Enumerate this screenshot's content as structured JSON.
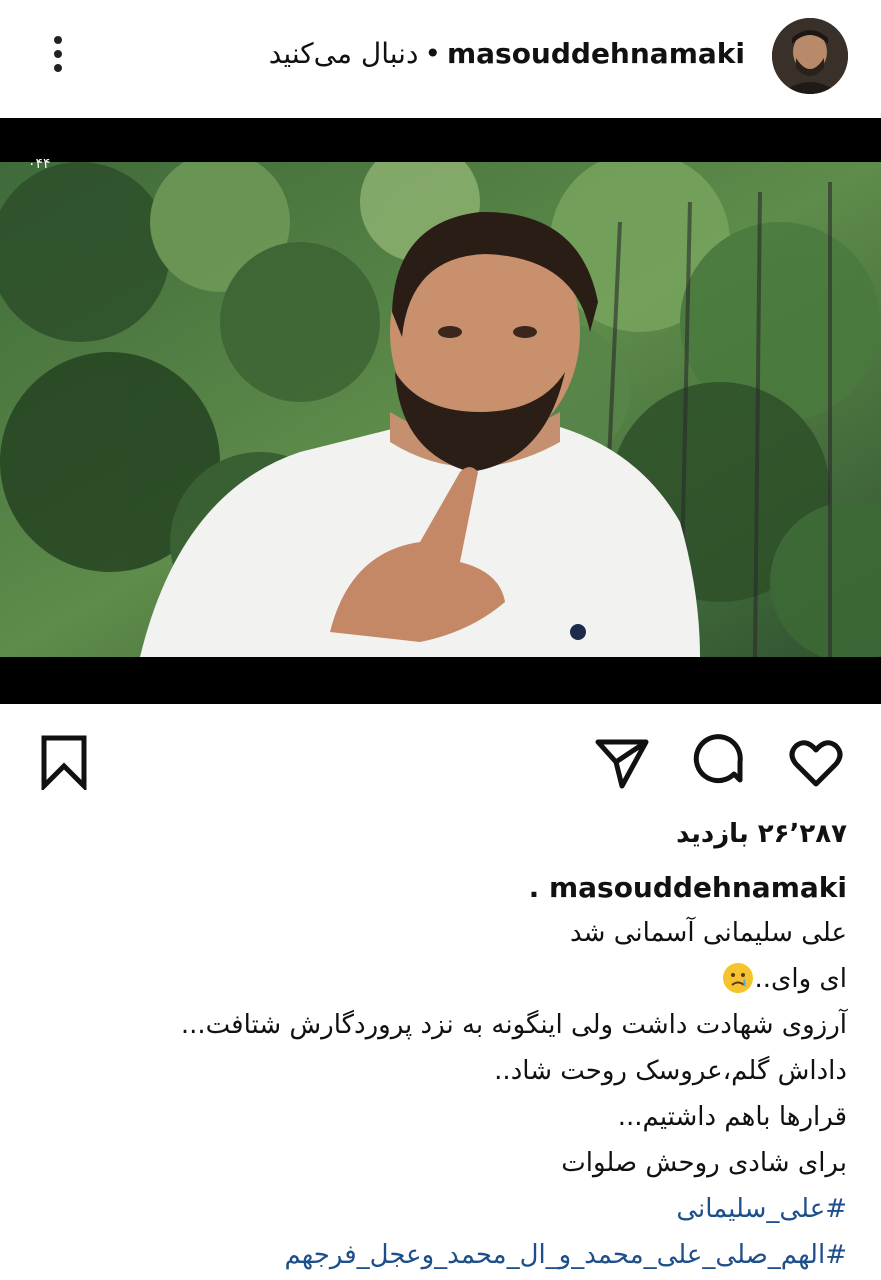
{
  "header": {
    "username": "masouddehnamaki",
    "separator": "•",
    "follow_label": "دنبال می‌کنید"
  },
  "icons": {
    "menu": "more-vertical-icon",
    "bookmark": "bookmark-icon",
    "share": "send-icon",
    "comment": "comment-icon",
    "like": "heart-icon",
    "emoji": "crying-face-emoji"
  },
  "video": {
    "watermark": "۰۴۴"
  },
  "stats": {
    "views": "۲۶٬۲۸۷ بازدید"
  },
  "caption": {
    "username": "masouddehnamaki",
    "suffix": ".",
    "lines": [
      "علی سلیمانی آسمانی شد",
      "ای وای..",
      "آرزوی شهادت داشت ولی اینگونه به نزد پروردگارش شتافت...",
      "داداش گلم،عروسک روحت شاد..",
      "قرارها باهم داشتیم...",
      "برای شادی روحش صلوات"
    ],
    "hashtags": [
      "#علی_سلیمانی",
      "#الهم_صلی_علی_محمد_و_ال_محمد_وعجل_فرجهم"
    ]
  },
  "colors": {
    "hashtag": "#1d4f8a",
    "background": "#ffffff",
    "video_bar": "#000000"
  }
}
